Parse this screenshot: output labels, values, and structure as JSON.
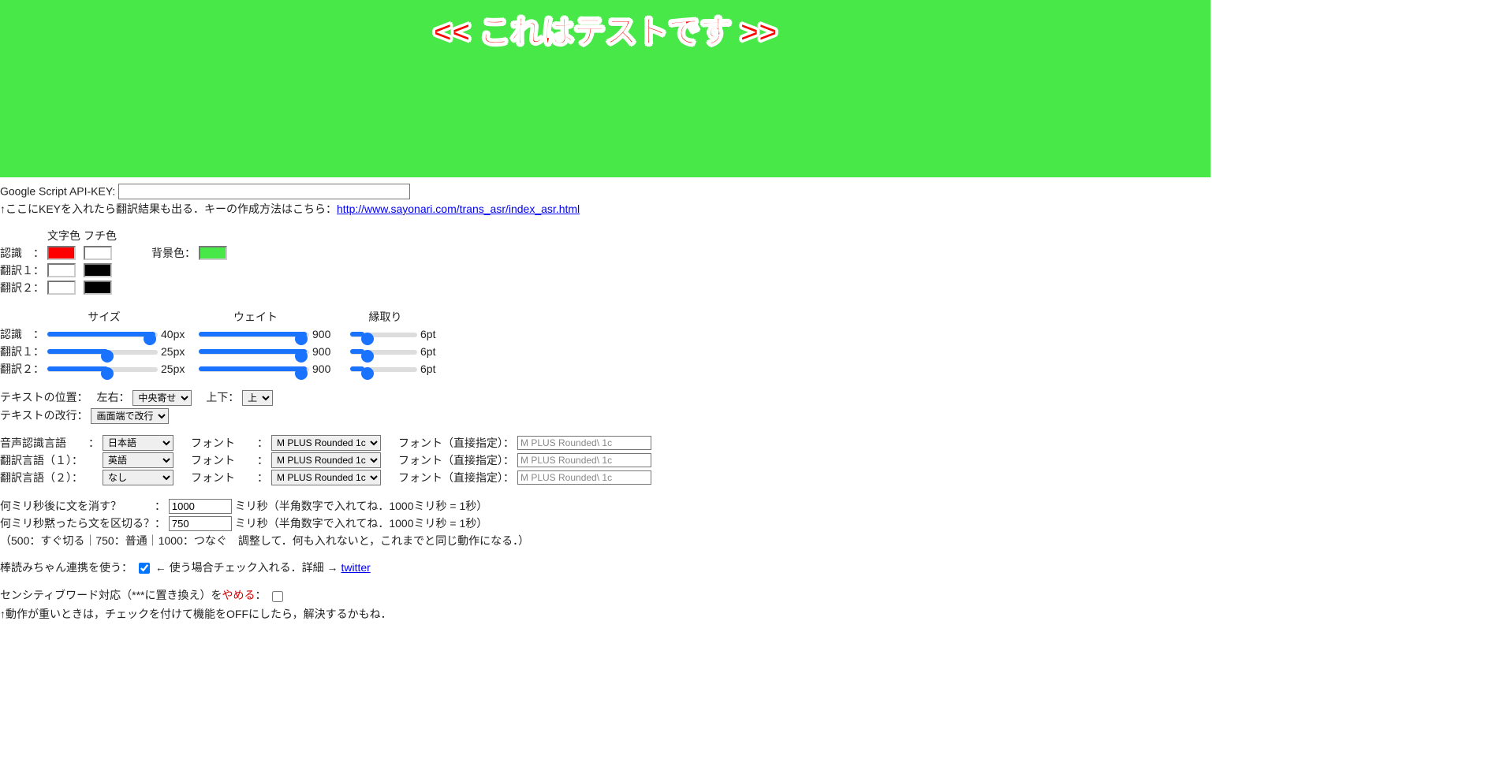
{
  "preview": {
    "text": "<< これはテストです >>"
  },
  "api": {
    "label": "Google Script API-KEY:",
    "value": "",
    "note_prefix": "↑ここにKEYを入れたら翻訳結果も出る．キーの作成方法はこちら：",
    "link": "http://www.sayonari.com/trans_asr/index_asr.html"
  },
  "colors": {
    "headers": {
      "text": "文字色",
      "stroke": "フチ色"
    },
    "rows": [
      "認識　：",
      "翻訳１：",
      "翻訳２："
    ],
    "bg_label": "背景色："
  },
  "sizes": {
    "headers": {
      "size": "サイズ",
      "weight": "ウェイト",
      "stroke": "縁取り"
    },
    "rows": [
      {
        "label": "認識　：",
        "size": "40px",
        "weight": "900",
        "stroke": "6pt"
      },
      {
        "label": "翻訳１：",
        "size": "25px",
        "weight": "900",
        "stroke": "6pt"
      },
      {
        "label": "翻訳２：",
        "size": "25px",
        "weight": "900",
        "stroke": "6pt"
      }
    ]
  },
  "position": {
    "label": "テキストの位置：",
    "lr_label": "左右：",
    "lr_value": "中央寄せ",
    "ud_label": "上下：",
    "ud_value": "上",
    "wrap_label": "テキストの改行：",
    "wrap_value": "画面端で改行"
  },
  "lang": {
    "rows": [
      {
        "label": "音声認識言語　　：",
        "value": "日本語"
      },
      {
        "label": "翻訳言語（１）：",
        "value": "英語"
      },
      {
        "label": "翻訳言語（２）：",
        "value": "なし"
      }
    ],
    "font_label": "フォント　　：",
    "font_value": "M PLUS Rounded 1c",
    "font_direct_label": "フォント（直接指定）：",
    "font_direct_value": "M PLUS Rounded\\ 1c"
  },
  "timing": {
    "erase_label": "何ミリ秒後に文を消す？　　　：",
    "erase_value": "1000",
    "erase_suffix": "ミリ秒（半角数字で入れてね．1000ミリ秒 = 1秒）",
    "split_label": "何ミリ秒黙ったら文を区切る？：",
    "split_value": "750",
    "split_suffix": "ミリ秒（半角数字で入れてね．1000ミリ秒 = 1秒）",
    "hint": "（500：すぐ切る｜750：普通｜1000：つなぐ　調整して．何も入れないと，これまでと同じ動作になる．）"
  },
  "bouyomi": {
    "label": "棒読みちゃん連携を使う：",
    "suffix": "← 使う場合チェック入れる．詳細 →",
    "link_label": "twitter"
  },
  "sensitive": {
    "label_prefix": "センシティブワード対応（***に置き換え）を",
    "label_red": "やめる",
    "label_suffix": "：",
    "note": "↑動作が重いときは，チェックを付けて機能をOFFにしたら，解決するかもね．"
  }
}
